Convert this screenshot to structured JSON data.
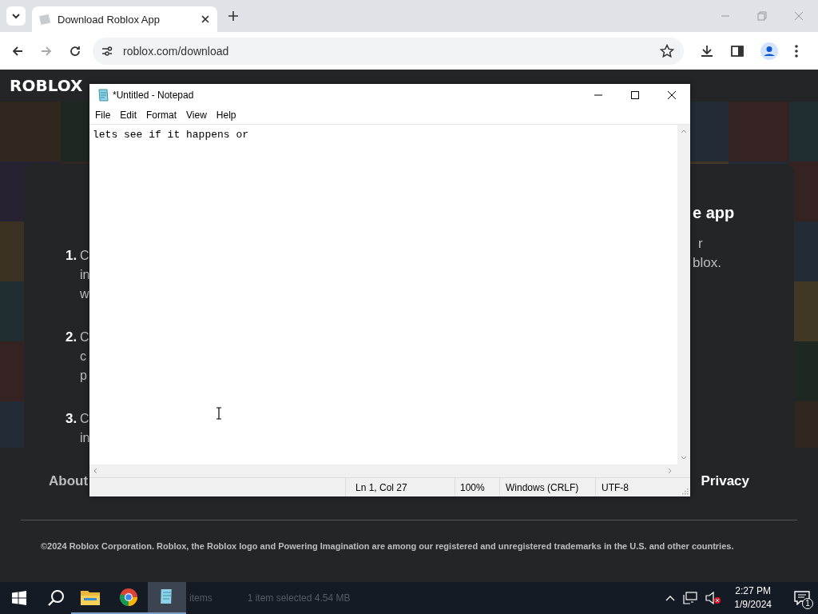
{
  "browser": {
    "tab": {
      "title": "Download Roblox App",
      "selected": true
    },
    "address": "roblox.com/download"
  },
  "page": {
    "logo": "ROBLOX",
    "steps": [
      {
        "number": "1.",
        "lines": [
          "C",
          "in",
          "w"
        ]
      },
      {
        "number": "2.",
        "lines": [
          "C",
          "c",
          "p"
        ]
      },
      {
        "number": "3.",
        "lines": [
          "C",
          "in"
        ]
      }
    ],
    "side": {
      "heading": "e app",
      "lines": [
        "r",
        "blox."
      ]
    },
    "footer_links": [
      "About",
      "Privacy"
    ],
    "copyright": "©2024 Roblox Corporation. Roblox, the Roblox logo and Powering Imagination are among our registered and unregistered trademarks in the U.S. and other countries."
  },
  "notepad": {
    "title": "*Untitled - Notepad",
    "menu": [
      "File",
      "Edit",
      "Format",
      "View",
      "Help"
    ],
    "text": "lets see if it happens or",
    "status": [
      "Ln 1, Col 27",
      "100%",
      "Windows (CRLF)",
      "UTF-8"
    ]
  },
  "taskbar": {
    "apps": [
      {
        "kind": "explorer",
        "selected": false
      },
      {
        "kind": "chrome",
        "selected": false
      },
      {
        "kind": "notepad",
        "selected": true
      }
    ],
    "ghost_texts": [
      "items",
      "1 item selected  4.54 MB"
    ],
    "time": "2:27 PM",
    "date": "1/9/2024",
    "notifications": "1"
  }
}
